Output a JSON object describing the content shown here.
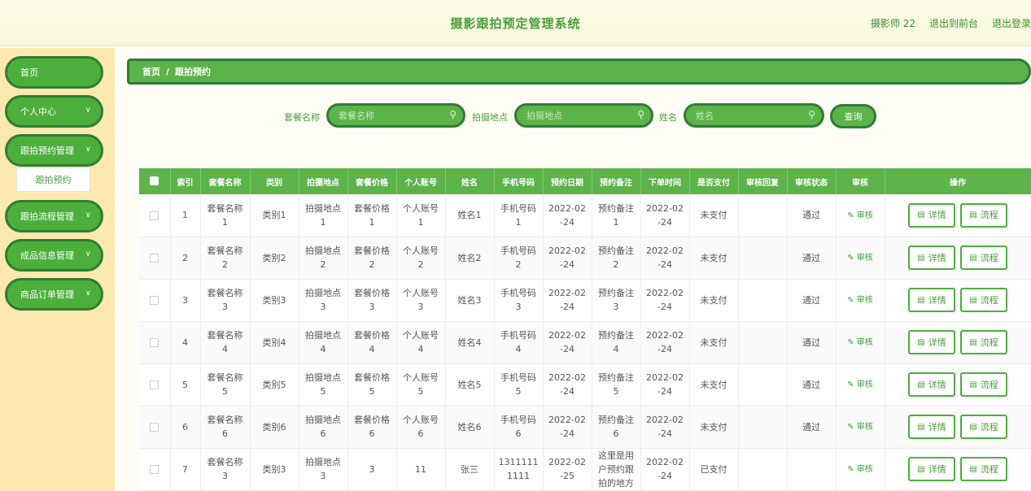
{
  "header": {
    "title": "摄影跟拍预定管理系统",
    "user": "摄影师 22",
    "front": "退出到前台",
    "logout": "退出登录"
  },
  "sidebar": {
    "items": [
      {
        "label": "首页"
      },
      {
        "label": "个人中心"
      },
      {
        "label": "跟拍预约管理"
      },
      {
        "label": "跟拍流程管理"
      },
      {
        "label": "成品信息管理"
      },
      {
        "label": "商品订单管理"
      }
    ],
    "sub": "跟拍预约"
  },
  "breadcrumb": {
    "home": "首页",
    "sep": "/",
    "current": "跟拍预约"
  },
  "search": {
    "f1_label": "套餐名称",
    "f1_placeholder": "套餐名称",
    "f2_label": "拍摄地点",
    "f2_placeholder": "拍摄地点",
    "f3_label": "姓名",
    "f3_placeholder": "姓名",
    "button": "查询"
  },
  "table": {
    "headers": [
      "索引",
      "套餐名称",
      "类别",
      "拍摄地点",
      "套餐价格",
      "个人账号",
      "姓名",
      "手机号码",
      "预约日期",
      "预约备注",
      "下单时间",
      "是否支付",
      "审核回复",
      "审核状态",
      "审核",
      "操作"
    ],
    "rows": [
      {
        "idx": "1",
        "pkg": "套餐名称\n1",
        "cat": "类别1",
        "place": "拍摄地点\n1",
        "price": "套餐价格\n1",
        "acct": "个人账号\n1",
        "name": "姓名1",
        "phone": "手机号码\n1",
        "date": "2022-02\n-24",
        "note": "预约备注\n1",
        "ordered": "2022-02\n-24",
        "paid": "未支付",
        "reply": "",
        "status": "通过"
      },
      {
        "idx": "2",
        "pkg": "套餐名称\n2",
        "cat": "类别2",
        "place": "拍摄地点\n2",
        "price": "套餐价格\n2",
        "acct": "个人账号\n2",
        "name": "姓名2",
        "phone": "手机号码\n2",
        "date": "2022-02\n-24",
        "note": "预约备注\n2",
        "ordered": "2022-02\n-24",
        "paid": "未支付",
        "reply": "",
        "status": "通过"
      },
      {
        "idx": "3",
        "pkg": "套餐名称\n3",
        "cat": "类别3",
        "place": "拍摄地点\n3",
        "price": "套餐价格\n3",
        "acct": "个人账号\n3",
        "name": "姓名3",
        "phone": "手机号码\n3",
        "date": "2022-02\n-24",
        "note": "预约备注\n3",
        "ordered": "2022-02\n-24",
        "paid": "未支付",
        "reply": "",
        "status": "通过"
      },
      {
        "idx": "4",
        "pkg": "套餐名称\n4",
        "cat": "类别4",
        "place": "拍摄地点\n4",
        "price": "套餐价格\n4",
        "acct": "个人账号\n4",
        "name": "姓名4",
        "phone": "手机号码\n4",
        "date": "2022-02\n-24",
        "note": "预约备注\n4",
        "ordered": "2022-02\n-24",
        "paid": "未支付",
        "reply": "",
        "status": "通过"
      },
      {
        "idx": "5",
        "pkg": "套餐名称\n5",
        "cat": "类别5",
        "place": "拍摄地点\n5",
        "price": "套餐价格\n5",
        "acct": "个人账号\n5",
        "name": "姓名5",
        "phone": "手机号码\n5",
        "date": "2022-02\n-24",
        "note": "预约备注\n5",
        "ordered": "2022-02\n-24",
        "paid": "未支付",
        "reply": "",
        "status": "通过"
      },
      {
        "idx": "6",
        "pkg": "套餐名称\n6",
        "cat": "类别6",
        "place": "拍摄地点\n6",
        "price": "套餐价格\n6",
        "acct": "个人账号\n6",
        "name": "姓名6",
        "phone": "手机号码\n6",
        "date": "2022-02\n-24",
        "note": "预约备注\n6",
        "ordered": "2022-02\n-24",
        "paid": "未支付",
        "reply": "",
        "status": "通过"
      },
      {
        "idx": "7",
        "pkg": "套餐名称\n3",
        "cat": "类别3",
        "place": "拍摄地点\n3",
        "price": "3",
        "acct": "11",
        "name": "张三",
        "phone": "1311111\n1111",
        "date": "2022-02\n-25",
        "note": "这里是用\n户预约跟\n拍的地方",
        "ordered": "2022-02\n-24",
        "paid": "已支付",
        "reply": "",
        "status": ""
      }
    ],
    "audit_label": "审核",
    "detail_label": "详情",
    "flow_label": "流程"
  },
  "colors": {
    "primary": "#5cb34a",
    "dark": "#2e7d32",
    "sidebar": "#fde9b0"
  },
  "icons": {
    "search": "search-icon",
    "chevron": "chevron-down-icon",
    "edit": "edit-icon",
    "doc": "document-icon"
  }
}
